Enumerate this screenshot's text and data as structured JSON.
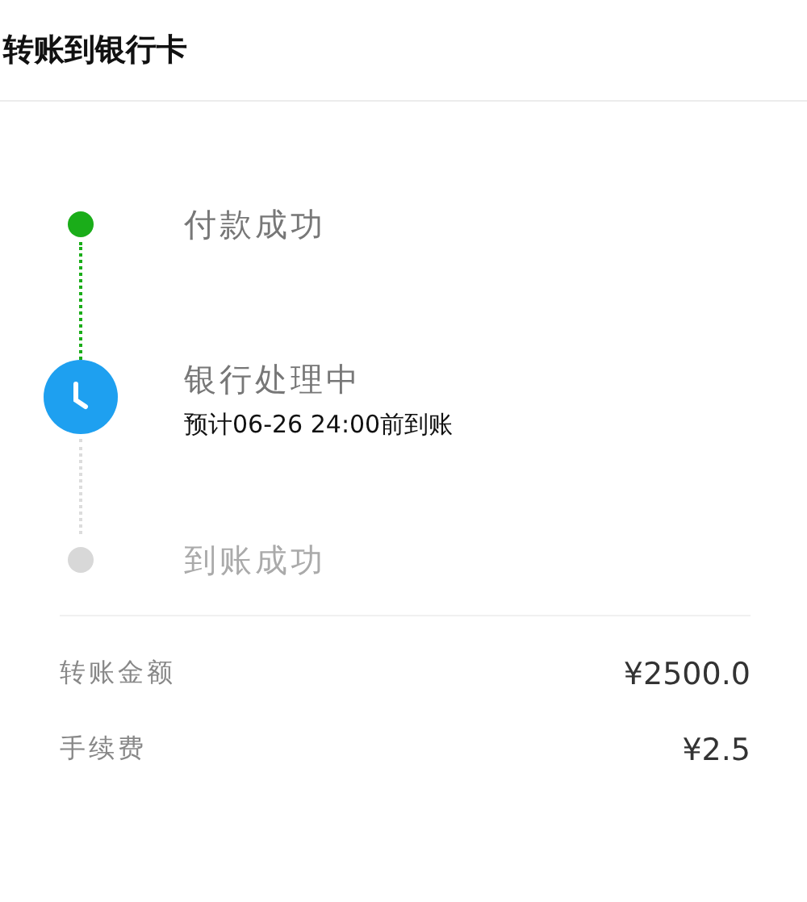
{
  "header": {
    "title": "转账到银行卡"
  },
  "steps": [
    {
      "title": "付款成功",
      "kind": "done"
    },
    {
      "title": "银行处理中",
      "kind": "current",
      "note": "预计06-26 24:00前到账"
    },
    {
      "title": "到账成功",
      "kind": "pending"
    }
  ],
  "details": [
    {
      "label": "转账金额",
      "value": "¥2500.0"
    },
    {
      "label": "手续费",
      "value": "¥2.5"
    }
  ]
}
